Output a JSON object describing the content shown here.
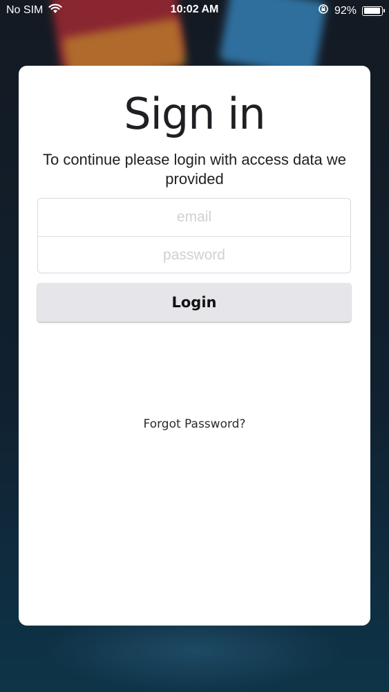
{
  "status_bar": {
    "carrier": "No SIM",
    "time": "10:02 AM",
    "battery_percent": "92%",
    "battery_level": 0.92,
    "icons": [
      "wifi-icon",
      "orientation-lock-icon",
      "battery-icon"
    ]
  },
  "login": {
    "title": "Sign in",
    "subtitle": "To continue please login with access data we provided",
    "email_placeholder": "email",
    "password_placeholder": "password",
    "login_label": "Login",
    "forgot_label": "Forgot Password?"
  }
}
